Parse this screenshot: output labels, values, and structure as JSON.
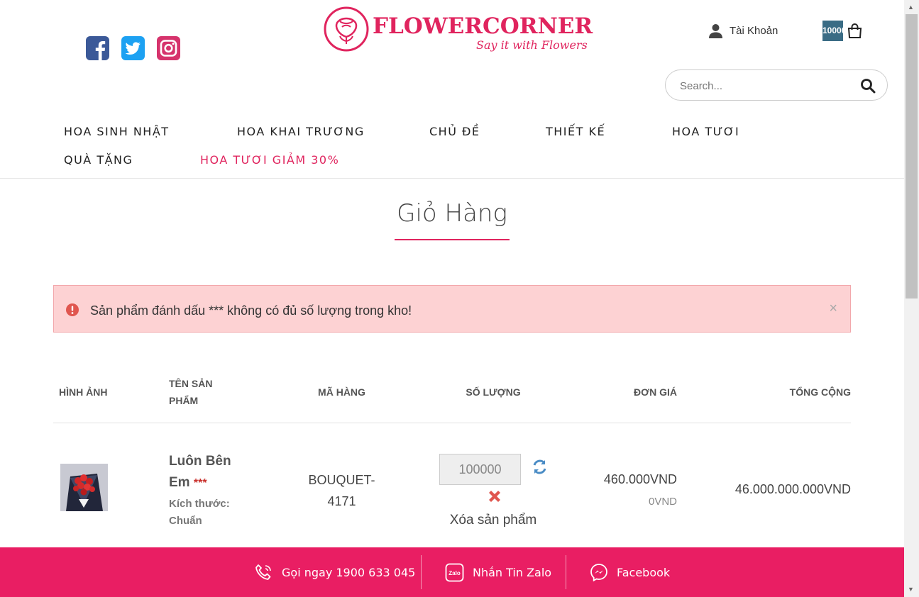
{
  "header": {
    "social": [
      "facebook-icon",
      "twitter-icon",
      "instagram-icon"
    ],
    "logo": {
      "name": "FLOWERCORNER",
      "tagline": "Say it with Flowers"
    },
    "account_label": "Tài Khoản",
    "cart_count": "10000",
    "search_placeholder": "Search..."
  },
  "nav": [
    {
      "label": "HOA SINH NHẬT"
    },
    {
      "label": "HOA KHAI TRƯƠNG"
    },
    {
      "label": "CHỦ ĐỀ"
    },
    {
      "label": "THIẾT KẾ"
    },
    {
      "label": "HOA TƯƠI"
    },
    {
      "label": "QUÀ TẶNG"
    },
    {
      "label": "HOA TƯƠI GIẢM 30%"
    }
  ],
  "page_title": "Giỏ Hàng",
  "alert": {
    "message": "Sản phẩm đánh dấu *** không có đủ số lượng trong kho!",
    "close": "×"
  },
  "table": {
    "headers": {
      "image": "HÌNH ẢNH",
      "name_line1": "TÊN SẢN",
      "name_line2": "PHẨM",
      "sku": "MÃ HÀNG",
      "qty": "SỐ LƯỢNG",
      "unit_price": "ĐƠN GIÁ",
      "total": "TỔNG CỘNG"
    },
    "rows": [
      {
        "name_line1": "Luôn Bên",
        "name_line2": "Em",
        "stock_mark": "***",
        "size_label": "Kích thước:",
        "size_value": "Chuẩn",
        "sku_line1": "BOUQUET-",
        "sku_line2": "4171",
        "quantity": "100000",
        "remove_label": "Xóa sản phẩm",
        "unit_price": "460.000VND",
        "discount": "0VND",
        "total": "46.000.000.000VND"
      }
    ]
  },
  "contact_bar": {
    "call": "Gọi ngay 1900 633 045",
    "zalo": "Nhắn Tin Zalo",
    "zalo_icon_text": "Zalo",
    "facebook": "Facebook"
  },
  "colors": {
    "brand": "#e91e63",
    "alert_bg": "#fdd2d3",
    "cart_badge": "#3a6c85"
  }
}
